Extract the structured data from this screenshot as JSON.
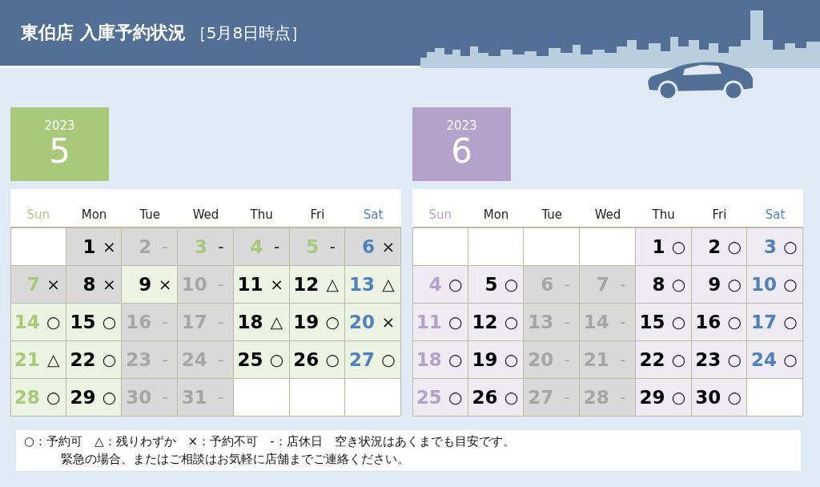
{
  "header": {
    "title": "東伯店 入庫予約状況",
    "date_note": "［5月8日時点］"
  },
  "months": [
    {
      "year": "2023",
      "month": "5",
      "color": "#a9c97a",
      "weekdays": [
        {
          "label": "Sun",
          "kind": "sun"
        },
        {
          "label": "Mon",
          "kind": "weekday"
        },
        {
          "label": "Tue",
          "kind": "weekday"
        },
        {
          "label": "Wed",
          "kind": "weekday"
        },
        {
          "label": "Thu",
          "kind": "weekday"
        },
        {
          "label": "Fri",
          "kind": "weekday"
        },
        {
          "label": "Sat",
          "kind": "sat"
        }
      ],
      "cells": [
        {
          "kind": "empty"
        },
        {
          "kind": "open",
          "day": "1",
          "mark": "×",
          "color": "#000000",
          "shaded": true
        },
        {
          "kind": "closed",
          "day": "2",
          "mark": "-"
        },
        {
          "kind": "open",
          "day": "3",
          "mark": "-",
          "color": "#a9c97a",
          "shaded": true
        },
        {
          "kind": "open",
          "day": "4",
          "mark": "-",
          "color": "#a9c97a",
          "shaded": true
        },
        {
          "kind": "open",
          "day": "5",
          "mark": "-",
          "color": "#a9c97a",
          "shaded": true
        },
        {
          "kind": "open",
          "day": "6",
          "mark": "×",
          "color": "#4f81bd",
          "shaded": true
        },
        {
          "kind": "open",
          "day": "7",
          "mark": "×",
          "color": "#a9c97a",
          "shaded": true
        },
        {
          "kind": "open",
          "day": "8",
          "mark": "×",
          "color": "#000000",
          "shaded": true
        },
        {
          "kind": "open",
          "day": "9",
          "mark": "×",
          "color": "#000000",
          "shaded": false
        },
        {
          "kind": "closed",
          "day": "10",
          "mark": "-"
        },
        {
          "kind": "open",
          "day": "11",
          "mark": "×",
          "color": "#000000",
          "shaded": false
        },
        {
          "kind": "open",
          "day": "12",
          "mark": "△",
          "color": "#000000",
          "shaded": false
        },
        {
          "kind": "open",
          "day": "13",
          "mark": "△",
          "color": "#4f81bd",
          "shaded": false
        },
        {
          "kind": "open",
          "day": "14",
          "mark": "○",
          "color": "#a9c97a",
          "shaded": false
        },
        {
          "kind": "open",
          "day": "15",
          "mark": "○",
          "color": "#000000",
          "shaded": false
        },
        {
          "kind": "closed",
          "day": "16",
          "mark": "-"
        },
        {
          "kind": "closed",
          "day": "17",
          "mark": "-"
        },
        {
          "kind": "open",
          "day": "18",
          "mark": "△",
          "color": "#000000",
          "shaded": false
        },
        {
          "kind": "open",
          "day": "19",
          "mark": "○",
          "color": "#000000",
          "shaded": false
        },
        {
          "kind": "open",
          "day": "20",
          "mark": "×",
          "color": "#4f81bd",
          "shaded": false
        },
        {
          "kind": "open",
          "day": "21",
          "mark": "△",
          "color": "#a9c97a",
          "shaded": false
        },
        {
          "kind": "open",
          "day": "22",
          "mark": "○",
          "color": "#000000",
          "shaded": false
        },
        {
          "kind": "closed",
          "day": "23",
          "mark": "-"
        },
        {
          "kind": "closed",
          "day": "24",
          "mark": "-"
        },
        {
          "kind": "open",
          "day": "25",
          "mark": "○",
          "color": "#000000",
          "shaded": false
        },
        {
          "kind": "open",
          "day": "26",
          "mark": "○",
          "color": "#000000",
          "shaded": false
        },
        {
          "kind": "open",
          "day": "27",
          "mark": "○",
          "color": "#4f81bd",
          "shaded": false
        },
        {
          "kind": "open",
          "day": "28",
          "mark": "○",
          "color": "#a9c97a",
          "shaded": false
        },
        {
          "kind": "open",
          "day": "29",
          "mark": "○",
          "color": "#000000",
          "shaded": false
        },
        {
          "kind": "closed",
          "day": "30",
          "mark": "-"
        },
        {
          "kind": "closed",
          "day": "31",
          "mark": "-"
        },
        {
          "kind": "empty"
        },
        {
          "kind": "empty"
        },
        {
          "kind": "empty"
        }
      ]
    },
    {
      "year": "2023",
      "month": "6",
      "color": "#b3a2c9",
      "weekdays": [
        {
          "label": "Sun",
          "kind": "sun"
        },
        {
          "label": "Mon",
          "kind": "weekday"
        },
        {
          "label": "Tue",
          "kind": "weekday"
        },
        {
          "label": "Wed",
          "kind": "weekday"
        },
        {
          "label": "Thu",
          "kind": "weekday"
        },
        {
          "label": "Fri",
          "kind": "weekday"
        },
        {
          "label": "Sat",
          "kind": "sat"
        }
      ],
      "cells": [
        {
          "kind": "empty"
        },
        {
          "kind": "empty"
        },
        {
          "kind": "empty"
        },
        {
          "kind": "empty"
        },
        {
          "kind": "open",
          "day": "1",
          "mark": "○",
          "color": "#000000",
          "shaded": false
        },
        {
          "kind": "open",
          "day": "2",
          "mark": "○",
          "color": "#000000",
          "shaded": false
        },
        {
          "kind": "open",
          "day": "3",
          "mark": "○",
          "color": "#4f81bd",
          "shaded": false
        },
        {
          "kind": "open",
          "day": "4",
          "mark": "○",
          "color": "#b3a2c9",
          "shaded": false
        },
        {
          "kind": "open",
          "day": "5",
          "mark": "○",
          "color": "#000000",
          "shaded": false
        },
        {
          "kind": "closed",
          "day": "6",
          "mark": "-"
        },
        {
          "kind": "closed",
          "day": "7",
          "mark": "-"
        },
        {
          "kind": "open",
          "day": "8",
          "mark": "○",
          "color": "#000000",
          "shaded": false
        },
        {
          "kind": "open",
          "day": "9",
          "mark": "○",
          "color": "#000000",
          "shaded": false
        },
        {
          "kind": "open",
          "day": "10",
          "mark": "○",
          "color": "#4f81bd",
          "shaded": false
        },
        {
          "kind": "open",
          "day": "11",
          "mark": "○",
          "color": "#b3a2c9",
          "shaded": false
        },
        {
          "kind": "open",
          "day": "12",
          "mark": "○",
          "color": "#000000",
          "shaded": false
        },
        {
          "kind": "closed",
          "day": "13",
          "mark": "-"
        },
        {
          "kind": "closed",
          "day": "14",
          "mark": "-"
        },
        {
          "kind": "open",
          "day": "15",
          "mark": "○",
          "color": "#000000",
          "shaded": false
        },
        {
          "kind": "open",
          "day": "16",
          "mark": "○",
          "color": "#000000",
          "shaded": false
        },
        {
          "kind": "open",
          "day": "17",
          "mark": "○",
          "color": "#4f81bd",
          "shaded": false
        },
        {
          "kind": "open",
          "day": "18",
          "mark": "○",
          "color": "#b3a2c9",
          "shaded": false
        },
        {
          "kind": "open",
          "day": "19",
          "mark": "○",
          "color": "#000000",
          "shaded": false
        },
        {
          "kind": "closed",
          "day": "20",
          "mark": "-"
        },
        {
          "kind": "closed",
          "day": "21",
          "mark": "-"
        },
        {
          "kind": "open",
          "day": "22",
          "mark": "○",
          "color": "#000000",
          "shaded": false
        },
        {
          "kind": "open",
          "day": "23",
          "mark": "○",
          "color": "#000000",
          "shaded": false
        },
        {
          "kind": "open",
          "day": "24",
          "mark": "○",
          "color": "#4f81bd",
          "shaded": false
        },
        {
          "kind": "open",
          "day": "25",
          "mark": "○",
          "color": "#b3a2c9",
          "shaded": false
        },
        {
          "kind": "open",
          "day": "26",
          "mark": "○",
          "color": "#000000",
          "shaded": false
        },
        {
          "kind": "closed",
          "day": "27",
          "mark": "-"
        },
        {
          "kind": "closed",
          "day": "28",
          "mark": "-"
        },
        {
          "kind": "open",
          "day": "29",
          "mark": "○",
          "color": "#000000",
          "shaded": false
        },
        {
          "kind": "open",
          "day": "30",
          "mark": "○",
          "color": "#000000",
          "shaded": false
        },
        {
          "kind": "empty"
        }
      ]
    }
  ],
  "legend": {
    "lines": [
      "○：予約可　△：残りわずか　×：予約不可　-：店休日　空き状況はあくまでも目安です。",
      "緊急の場合、またはご相談はお気軽に店舗までご連絡ください。"
    ]
  }
}
